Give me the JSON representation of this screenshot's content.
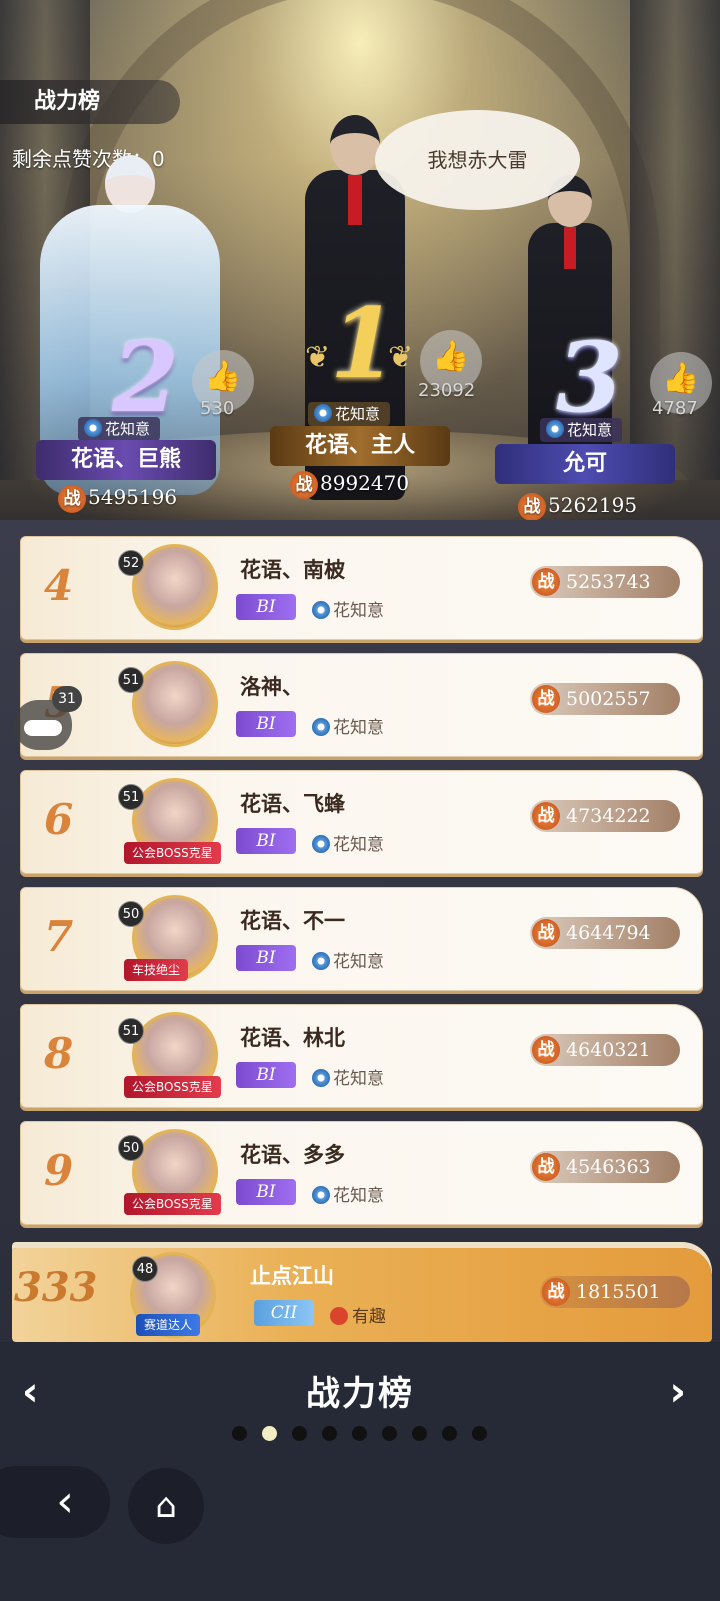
{
  "header": {
    "title": "战力榜",
    "likes_remaining": "剩余点赞次数：0"
  },
  "speech_bubble": "我想赤大雷",
  "podium": [
    {
      "rank": "2",
      "guild": "花知意",
      "name": "花语、巨熊",
      "power": "5495196",
      "likes": "530"
    },
    {
      "rank": "1",
      "guild": "花知意",
      "name": "花语、主人",
      "power": "8992470",
      "likes": "23092"
    },
    {
      "rank": "3",
      "guild": "花知意",
      "name": "允可",
      "power": "5262195",
      "likes": "4787"
    }
  ],
  "power_icon": "战",
  "rows": [
    {
      "rank": "4",
      "level": "52",
      "name": "花语、南柀",
      "tier": "BI",
      "guild": "花知意",
      "power": "5253743",
      "badge": ""
    },
    {
      "rank": "5",
      "level": "51",
      "name": "洛神、",
      "tier": "BI",
      "guild": "花知意",
      "power": "5002557",
      "badge": ""
    },
    {
      "rank": "6",
      "level": "51",
      "name": "花语、飞蜂",
      "tier": "BI",
      "guild": "花知意",
      "power": "4734222",
      "badge": "公会BOSS克星"
    },
    {
      "rank": "7",
      "level": "50",
      "name": "花语、不一",
      "tier": "BI",
      "guild": "花知意",
      "power": "4644794",
      "badge": "车技绝尘"
    },
    {
      "rank": "8",
      "level": "51",
      "name": "花语、林北",
      "tier": "BI",
      "guild": "花知意",
      "power": "4640321",
      "badge": "公会BOSS克星"
    },
    {
      "rank": "9",
      "level": "50",
      "name": "花语、多多",
      "tier": "BI",
      "guild": "花知意",
      "power": "4546363",
      "badge": "公会BOSS克星"
    }
  ],
  "chat_badge": "31",
  "self": {
    "rank": "333",
    "level": "48",
    "name": "止点江山",
    "tier": "CII",
    "guild": "有趣",
    "power": "1815501",
    "badge": "赛道达人"
  },
  "footer": {
    "title": "战力榜",
    "page_count": 9,
    "active_page": 1
  },
  "colors": {
    "accent": "#d9843a",
    "tier_b": "#8a5ae0",
    "tier_c": "#6aaee8",
    "self_row": "#eab055"
  },
  "icons": [
    "thumbs-up-icon",
    "laurel-icon",
    "flower-icon",
    "chat-icon",
    "back-icon",
    "home-icon"
  ]
}
